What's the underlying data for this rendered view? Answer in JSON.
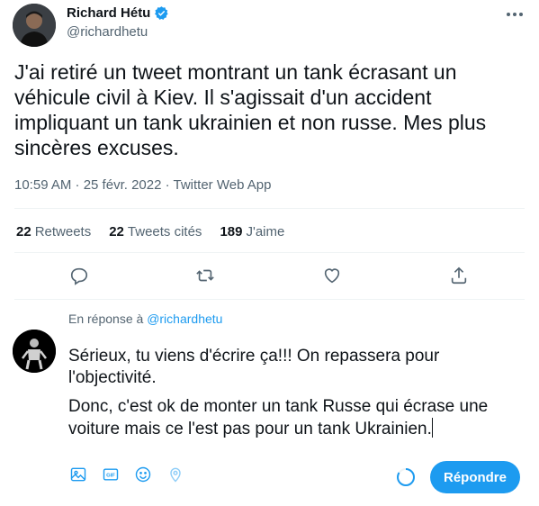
{
  "tweet": {
    "author_name": "Richard Hétu",
    "author_handle": "@richardhetu",
    "text": "J'ai retiré un tweet montrant un tank écrasant un véhicule civil à Kiev. Il s'agissait d'un accident impliquant un tank ukrainien et non russe. Mes plus sincères excuses.",
    "meta": "10:59 AM · 25 févr. 2022 · Twitter Web App"
  },
  "stats": {
    "retweets_count": "22",
    "retweets_label": "Retweets",
    "quotes_count": "22",
    "quotes_label": "Tweets cités",
    "likes_count": "189",
    "likes_label": "J'aime"
  },
  "reply": {
    "in_reply_prefix": "En réponse à",
    "in_reply_handle": "@richardhetu",
    "line1": "Sérieux, tu viens d'écrire ça!!! On repassera pour l'objectivité.",
    "line2": "Donc, c'est ok de monter un tank Russe qui écrase une voiture mais ce l'est pas pour un tank Ukrainien.",
    "button_label": "Répondre"
  },
  "colors": {
    "accent": "#1d9bf0",
    "text_secondary": "#536471"
  },
  "icons": [
    "verified-badge-icon",
    "more-icon",
    "reply-icon",
    "retweet-icon",
    "like-icon",
    "share-icon",
    "image-icon",
    "gif-icon",
    "emoji-icon",
    "location-icon"
  ]
}
